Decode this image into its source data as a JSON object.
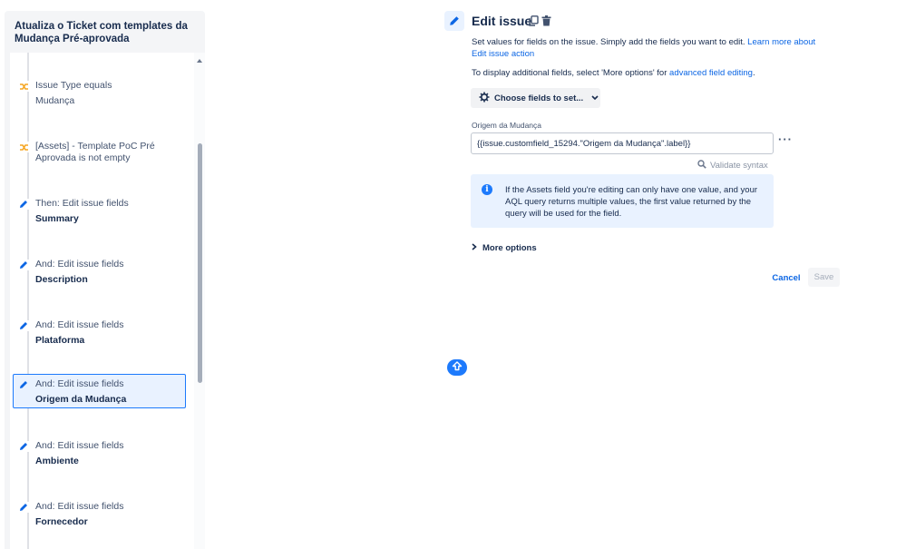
{
  "rule": {
    "title": "Atualiza o Ticket com templates da Mudança Pré-aprovada",
    "items": [
      {
        "title": "Issue Type equals",
        "sub": "Mudança",
        "icon": "condition-icon",
        "selected": false
      },
      {
        "title": "[Assets] - Template PoC Pré",
        "sub": "Aprovada is not empty",
        "icon": "condition-icon",
        "selected": false
      },
      {
        "title": "Then: Edit issue fields",
        "sub": "Summary",
        "icon": "pencil-icon",
        "selected": false
      },
      {
        "title": "And: Edit issue fields",
        "sub": "Description",
        "icon": "pencil-icon",
        "selected": false
      },
      {
        "title": "And: Edit issue fields",
        "sub": "Plataforma",
        "icon": "pencil-icon",
        "selected": false
      },
      {
        "title": "And: Edit issue fields",
        "sub": "Origem da Mudança",
        "icon": "pencil-icon",
        "selected": true
      },
      {
        "title": "And: Edit issue fields",
        "sub": "Ambiente",
        "icon": "pencil-icon",
        "selected": false
      },
      {
        "title": "And: Edit issue fields",
        "sub": "Fornecedor",
        "icon": "pencil-icon",
        "selected": false
      }
    ]
  },
  "edit": {
    "title": "Edit issue",
    "desc_text": "Set values for fields on the issue. Simply add the fields you want to edit.",
    "desc_link": "Learn more about Edit issue action",
    "desc2_text": "To display additional fields, select 'More options' for",
    "desc2_link": "advanced field editing",
    "desc2_end": ".",
    "choose_label": "Choose fields to set...",
    "field_label": "Origem da Mudança",
    "field_value": "{{issue.customfield_15294.\"Origem da Mudança\".label}}",
    "validate_label": "Validate syntax",
    "info_text": "If the Assets field you're editing can only have one value, and your AQL query returns multiple values, the first value returned by the query will be used for the field.",
    "more_options_label": "More options",
    "cancel_label": "Cancel",
    "save_label": "Save"
  },
  "colors": {
    "accent": "#0C66E4",
    "selected_bg": "#E9F2FF",
    "condition": "#F5A623"
  }
}
